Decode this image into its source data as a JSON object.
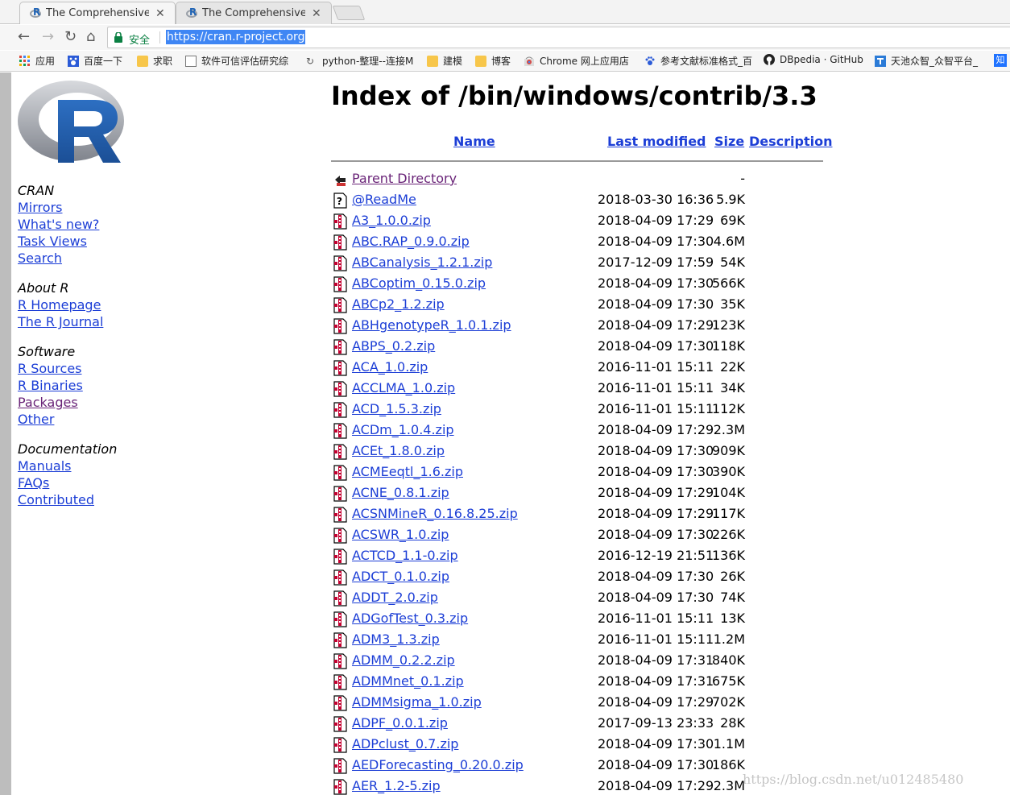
{
  "browser": {
    "tabs": [
      {
        "title": "The Comprehensive R",
        "active": true
      },
      {
        "title": "The Comprehensive R",
        "active": false
      }
    ],
    "secure_label": "安全",
    "url": "https://cran.r-project.org",
    "bookmarks": [
      {
        "label": "应用",
        "icon": "apps-grid-icon"
      },
      {
        "label": "百度一下",
        "icon": "baidu-paw-icon"
      },
      {
        "label": "求职",
        "icon": "folder-icon"
      },
      {
        "label": "软件可信评估研究综",
        "icon": "page-icon"
      },
      {
        "label": "python-整理--连接M",
        "icon": "python-icon"
      },
      {
        "label": "建模",
        "icon": "folder-icon"
      },
      {
        "label": "博客",
        "icon": "folder-icon"
      },
      {
        "label": "Chrome 网上应用店",
        "icon": "chrome-store-icon"
      },
      {
        "label": "参考文献标准格式_百",
        "icon": "baidu-paw-icon"
      },
      {
        "label": "DBpedia · GitHub",
        "icon": "github-icon"
      },
      {
        "label": "天池众智_众智平台_",
        "icon": "tianchi-icon"
      },
      {
        "label": "知",
        "icon": "zhihu-icon"
      }
    ]
  },
  "sidebar": {
    "groups": [
      {
        "heading": "CRAN",
        "links": [
          {
            "label": "Mirrors"
          },
          {
            "label": "What's new?"
          },
          {
            "label": "Task Views"
          },
          {
            "label": "Search"
          }
        ]
      },
      {
        "heading": "About R",
        "links": [
          {
            "label": "R Homepage"
          },
          {
            "label": "The R Journal"
          }
        ]
      },
      {
        "heading": "Software",
        "links": [
          {
            "label": "R Sources"
          },
          {
            "label": "R Binaries"
          },
          {
            "label": "Packages",
            "visited": true
          },
          {
            "label": "Other"
          }
        ]
      },
      {
        "heading": "Documentation",
        "links": [
          {
            "label": "Manuals"
          },
          {
            "label": "FAQs"
          },
          {
            "label": "Contributed"
          }
        ]
      }
    ]
  },
  "page": {
    "title": "Index of /bin/windows/contrib/3.3",
    "columns": {
      "name": "Name",
      "last_modified": "Last modified",
      "size": "Size",
      "description": "Description"
    }
  },
  "entries": [
    {
      "name": "Parent Directory",
      "date": "",
      "size": "-",
      "icon": "back-arrow-icon",
      "visited": true
    },
    {
      "name": "@ReadMe",
      "date": "2018-03-30 16:36",
      "size": "5.9K",
      "icon": "unknown-file-icon"
    },
    {
      "name": "A3_1.0.0.zip",
      "date": "2018-04-09 17:29",
      "size": "69K",
      "icon": "compressed-file-icon"
    },
    {
      "name": "ABC.RAP_0.9.0.zip",
      "date": "2018-04-09 17:30",
      "size": "4.6M",
      "icon": "compressed-file-icon"
    },
    {
      "name": "ABCanalysis_1.2.1.zip",
      "date": "2017-12-09 17:59",
      "size": "54K",
      "icon": "compressed-file-icon"
    },
    {
      "name": "ABCoptim_0.15.0.zip",
      "date": "2018-04-09 17:30",
      "size": "566K",
      "icon": "compressed-file-icon"
    },
    {
      "name": "ABCp2_1.2.zip",
      "date": "2018-04-09 17:30",
      "size": "35K",
      "icon": "compressed-file-icon"
    },
    {
      "name": "ABHgenotypeR_1.0.1.zip",
      "date": "2018-04-09 17:29",
      "size": "123K",
      "icon": "compressed-file-icon"
    },
    {
      "name": "ABPS_0.2.zip",
      "date": "2018-04-09 17:30",
      "size": "118K",
      "icon": "compressed-file-icon"
    },
    {
      "name": "ACA_1.0.zip",
      "date": "2016-11-01 15:11",
      "size": "22K",
      "icon": "compressed-file-icon"
    },
    {
      "name": "ACCLMA_1.0.zip",
      "date": "2016-11-01 15:11",
      "size": "34K",
      "icon": "compressed-file-icon"
    },
    {
      "name": "ACD_1.5.3.zip",
      "date": "2016-11-01 15:11",
      "size": "112K",
      "icon": "compressed-file-icon"
    },
    {
      "name": "ACDm_1.0.4.zip",
      "date": "2018-04-09 17:29",
      "size": "2.3M",
      "icon": "compressed-file-icon"
    },
    {
      "name": "ACEt_1.8.0.zip",
      "date": "2018-04-09 17:30",
      "size": "909K",
      "icon": "compressed-file-icon"
    },
    {
      "name": "ACMEeqtl_1.6.zip",
      "date": "2018-04-09 17:30",
      "size": "390K",
      "icon": "compressed-file-icon"
    },
    {
      "name": "ACNE_0.8.1.zip",
      "date": "2018-04-09 17:29",
      "size": "104K",
      "icon": "compressed-file-icon"
    },
    {
      "name": "ACSNMineR_0.16.8.25.zip",
      "date": "2018-04-09 17:29",
      "size": "117K",
      "icon": "compressed-file-icon"
    },
    {
      "name": "ACSWR_1.0.zip",
      "date": "2018-04-09 17:30",
      "size": "226K",
      "icon": "compressed-file-icon"
    },
    {
      "name": "ACTCD_1.1-0.zip",
      "date": "2016-12-19 21:51",
      "size": "136K",
      "icon": "compressed-file-icon"
    },
    {
      "name": "ADCT_0.1.0.zip",
      "date": "2018-04-09 17:30",
      "size": "26K",
      "icon": "compressed-file-icon"
    },
    {
      "name": "ADDT_2.0.zip",
      "date": "2018-04-09 17:30",
      "size": "74K",
      "icon": "compressed-file-icon"
    },
    {
      "name": "ADGofTest_0.3.zip",
      "date": "2016-11-01 15:11",
      "size": "13K",
      "icon": "compressed-file-icon"
    },
    {
      "name": "ADM3_1.3.zip",
      "date": "2016-11-01 15:11",
      "size": "1.2M",
      "icon": "compressed-file-icon"
    },
    {
      "name": "ADMM_0.2.2.zip",
      "date": "2018-04-09 17:31",
      "size": "840K",
      "icon": "compressed-file-icon"
    },
    {
      "name": "ADMMnet_0.1.zip",
      "date": "2018-04-09 17:31",
      "size": "675K",
      "icon": "compressed-file-icon"
    },
    {
      "name": "ADMMsigma_1.0.zip",
      "date": "2018-04-09 17:29",
      "size": "702K",
      "icon": "compressed-file-icon"
    },
    {
      "name": "ADPF_0.0.1.zip",
      "date": "2017-09-13 23:33",
      "size": "28K",
      "icon": "compressed-file-icon"
    },
    {
      "name": "ADPclust_0.7.zip",
      "date": "2018-04-09 17:30",
      "size": "1.1M",
      "icon": "compressed-file-icon"
    },
    {
      "name": "AEDForecasting_0.20.0.zip",
      "date": "2018-04-09 17:30",
      "size": "186K",
      "icon": "compressed-file-icon"
    },
    {
      "name": "AER_1.2-5.zip",
      "date": "2018-04-09 17:29",
      "size": "2.3M",
      "icon": "compressed-file-icon"
    }
  ],
  "watermark": "https://blog.csdn.net/u012485480",
  "colors": {
    "link": "#1c3ed6",
    "visited": "#6a2478",
    "secure": "#0b8043",
    "url_highlight": "#3f86f4"
  }
}
